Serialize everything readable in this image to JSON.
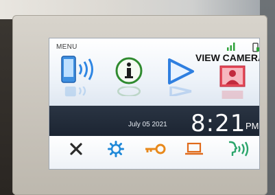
{
  "screen": {
    "menu_label": "MENU",
    "view_camera_label": "VIEW CAMERA",
    "date": "July 05 2021",
    "time": "8:21",
    "ampm": "PM"
  },
  "top_buttons": [
    {
      "name": "intercom-phone-button",
      "icon": "phone-wave-icon"
    },
    {
      "name": "info-button",
      "icon": "info-icon"
    },
    {
      "name": "play-button",
      "icon": "play-icon"
    },
    {
      "name": "view-camera-button",
      "icon": "person-camera-icon"
    }
  ],
  "bottom_buttons": [
    {
      "name": "close-button",
      "icon": "close-icon"
    },
    {
      "name": "settings-button",
      "icon": "gear-icon"
    },
    {
      "name": "door-unlock-button",
      "icon": "key-icon"
    },
    {
      "name": "monitor-button",
      "icon": "laptop-icon"
    },
    {
      "name": "voice-button",
      "icon": "speaking-head-icon"
    }
  ],
  "colors": {
    "band": "#1c2532",
    "info_green": "#2f8a2f",
    "play_blue": "#2f7fe0",
    "key_orange": "#e8891c",
    "laptop_orange": "#e06a1a",
    "voice_green": "#2aa56b",
    "gear_blue": "#1e88d8"
  }
}
